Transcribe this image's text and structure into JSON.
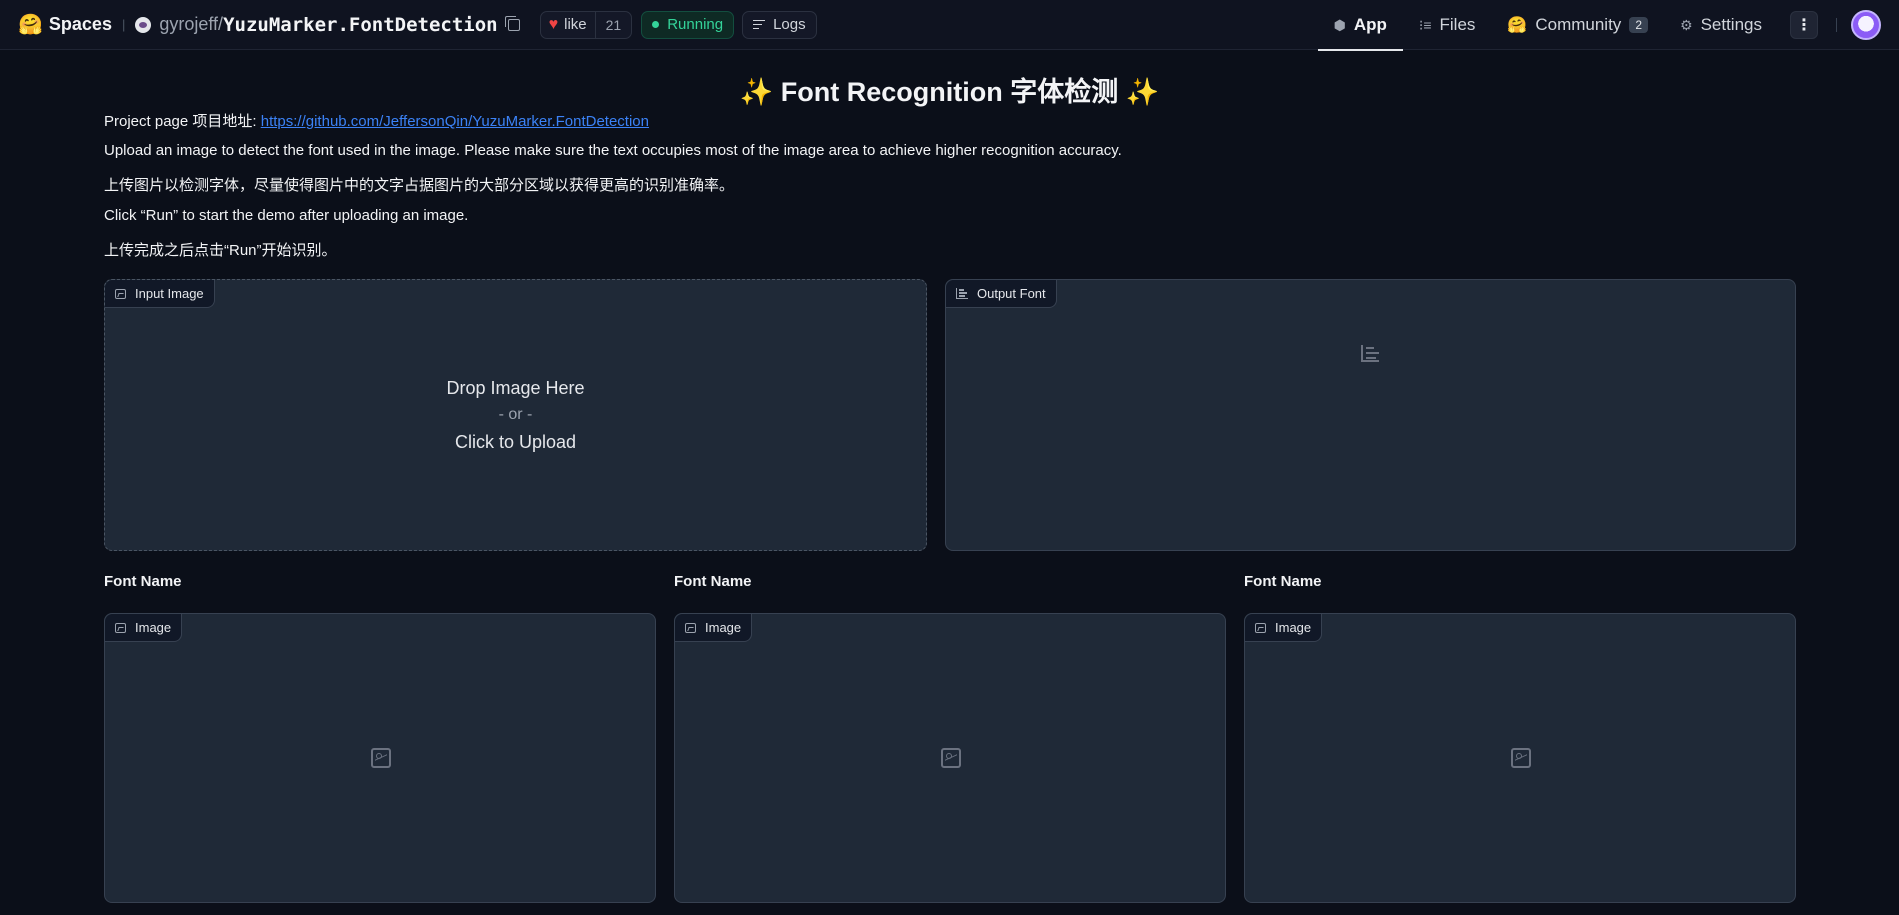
{
  "topbar": {
    "brand": "Spaces",
    "brand_icon": "hugging-face-icon",
    "owner": "gyrojeff",
    "repo": "YuzuMarker.FontDetection",
    "like_label": "like",
    "like_count": "21",
    "status": "Running",
    "logs_label": "Logs",
    "tabs": [
      {
        "label": "App",
        "icon": "cube-icon",
        "active": true
      },
      {
        "label": "Files",
        "icon": "files-icon",
        "active": false
      },
      {
        "label": "Community",
        "icon": "community-icon",
        "active": false,
        "badge": "2"
      },
      {
        "label": "Settings",
        "icon": "gear-icon",
        "active": false
      }
    ]
  },
  "main": {
    "title": "✨ Font Recognition 字体检测 ✨",
    "project_label": "Project page 项目地址: ",
    "project_link": "https://github.com/JeffersonQin/YuzuMarker.FontDetection",
    "desc_en": "Upload an image to detect the font used in the image. Please make sure the text occupies most of the image area to achieve higher recognition accuracy.",
    "desc_zh": "上传图片以检测字体，尽量使得图片中的文字占据图片的大部分区域以获得更高的识别准确率。",
    "run_en": "Click “Run” to start the demo after uploading an image.",
    "run_zh": "上传完成之后点击“Run”开始识别。",
    "input_label": "Input Image",
    "drop_text": "Drop Image Here",
    "or_text": "- or -",
    "click_text": "Click to Upload",
    "output_label": "Output Font",
    "results": [
      {
        "font_label": "Font Name",
        "image_label": "Image"
      },
      {
        "font_label": "Font Name",
        "image_label": "Image"
      },
      {
        "font_label": "Font Name",
        "image_label": "Image"
      }
    ]
  },
  "colors": {
    "background": "#0b0f19",
    "panel": "#1f2937",
    "accent_link": "#3b82f6",
    "status_green": "#34d399",
    "like_red": "#ef4444"
  }
}
